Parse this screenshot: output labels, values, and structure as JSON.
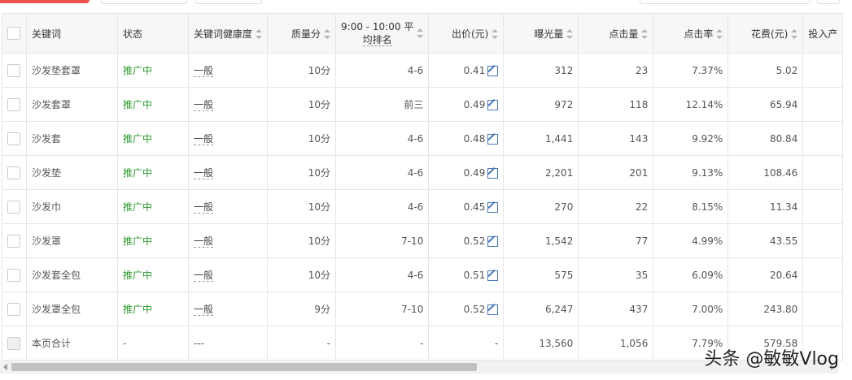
{
  "columns": {
    "keyword": "关键词",
    "status": "状态",
    "health": "关键词健康度",
    "quality": "质量分",
    "avg_rank_line1": "9:00 - 10:00 平",
    "avg_rank_line2": "均排名",
    "bid": "出价(元)",
    "impressions": "曝光量",
    "clicks": "点击量",
    "ctr": "点击率",
    "cost": "花费(元)",
    "roi": "投入产"
  },
  "rows": [
    {
      "keyword": "沙发垫套罩",
      "status": "推广中",
      "health": "一般",
      "quality": "10分",
      "rank": "4-6",
      "bid": "0.41",
      "impressions": "312",
      "clicks": "23",
      "ctr": "7.37%",
      "cost": "5.02"
    },
    {
      "keyword": "沙发套罩",
      "status": "推广中",
      "health": "一般",
      "quality": "10分",
      "rank": "前三",
      "bid": "0.49",
      "impressions": "972",
      "clicks": "118",
      "ctr": "12.14%",
      "cost": "65.94"
    },
    {
      "keyword": "沙发套",
      "status": "推广中",
      "health": "一般",
      "quality": "10分",
      "rank": "4-6",
      "bid": "0.48",
      "impressions": "1,441",
      "clicks": "143",
      "ctr": "9.92%",
      "cost": "80.84"
    },
    {
      "keyword": "沙发垫",
      "status": "推广中",
      "health": "一般",
      "quality": "10分",
      "rank": "4-6",
      "bid": "0.49",
      "impressions": "2,201",
      "clicks": "201",
      "ctr": "9.13%",
      "cost": "108.46"
    },
    {
      "keyword": "沙发巾",
      "status": "推广中",
      "health": "一般",
      "quality": "10分",
      "rank": "4-6",
      "bid": "0.45",
      "impressions": "270",
      "clicks": "22",
      "ctr": "8.15%",
      "cost": "11.34"
    },
    {
      "keyword": "沙发罩",
      "status": "推广中",
      "health": "一般",
      "quality": "10分",
      "rank": "7-10",
      "bid": "0.52",
      "impressions": "1,542",
      "clicks": "77",
      "ctr": "4.99%",
      "cost": "43.55"
    },
    {
      "keyword": "沙发套全包",
      "status": "推广中",
      "health": "一般",
      "quality": "10分",
      "rank": "4-6",
      "bid": "0.51",
      "impressions": "575",
      "clicks": "35",
      "ctr": "6.09%",
      "cost": "20.64"
    },
    {
      "keyword": "沙发罩全包",
      "status": "推广中",
      "health": "一般",
      "quality": "9分",
      "rank": "7-10",
      "bid": "0.52",
      "impressions": "6,247",
      "clicks": "437",
      "ctr": "7.00%",
      "cost": "243.80"
    }
  ],
  "total": {
    "label": "本页合计",
    "status": "-",
    "health": "---",
    "quality": "-",
    "rank": "-",
    "bid": "-",
    "impressions": "13,560",
    "clicks": "1,056",
    "ctr": "7.79%",
    "cost": "579.58"
  },
  "watermark": "头条 @敏敏Vlog",
  "colors": {
    "status_active": "#2e9a2e",
    "header_bg": "#f7f7f7",
    "accent_red": "#f05050"
  },
  "icons": {
    "sort": "sort-arrows-icon",
    "edit": "edit-icon",
    "checkbox": "checkbox"
  }
}
